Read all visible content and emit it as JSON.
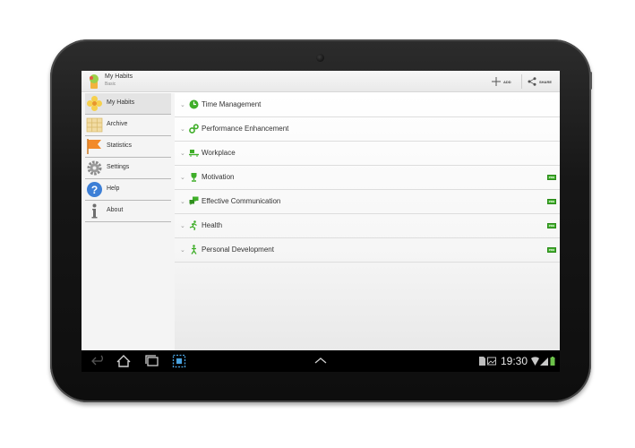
{
  "app": {
    "title": "My Habits",
    "subtitle": "Basic"
  },
  "actions": {
    "add_label": "ADD",
    "share_label": "SHARE"
  },
  "sidebar": {
    "items": [
      {
        "label": "My Habits",
        "icon": "flower-icon"
      },
      {
        "label": "Archive",
        "icon": "archive-grid-icon"
      },
      {
        "label": "Statistics",
        "icon": "flag-icon"
      },
      {
        "label": "Settings",
        "icon": "gear-icon"
      },
      {
        "label": "Help",
        "icon": "question-icon"
      },
      {
        "label": "About",
        "icon": "info-icon"
      }
    ]
  },
  "categories": [
    {
      "label": "Time Management",
      "icon": "clock-icon",
      "pro": false
    },
    {
      "label": "Performance Enhancement",
      "icon": "gears-icon",
      "pro": false
    },
    {
      "label": "Workplace",
      "icon": "desk-icon",
      "pro": false
    },
    {
      "label": "Motivation",
      "icon": "trophy-icon",
      "pro": true
    },
    {
      "label": "Effective Communication",
      "icon": "chat-icon",
      "pro": true
    },
    {
      "label": "Health",
      "icon": "runner-icon",
      "pro": true
    },
    {
      "label": "Personal Development",
      "icon": "climber-icon",
      "pro": true
    }
  ],
  "pro_badge": "PRO",
  "status": {
    "time": "19:30"
  },
  "colors": {
    "accent_green": "#3fae29",
    "sidebar_bg": "#f4f4f4",
    "navbar_bg": "#000000"
  }
}
